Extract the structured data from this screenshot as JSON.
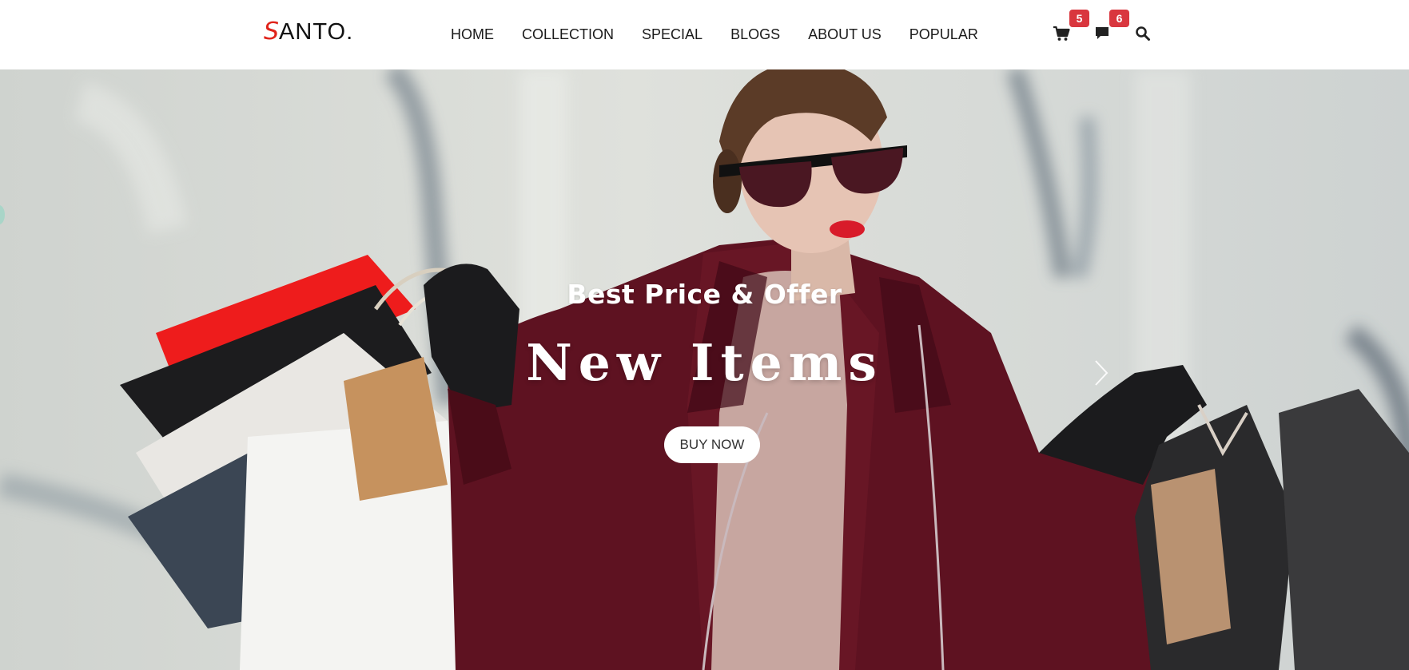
{
  "brand": {
    "logo_first": "S",
    "logo_rest": "ANTO.",
    "accent": "#e0241b"
  },
  "nav": {
    "items": [
      "HOME",
      "COLLECTION",
      "SPECIAL",
      "BLOGS",
      "ABOUT US",
      "POPULAR"
    ]
  },
  "header_icons": {
    "cart": {
      "icon": "cart-icon",
      "count": "5"
    },
    "messages": {
      "icon": "chat-icon",
      "count": "6"
    },
    "search": {
      "icon": "search-icon"
    },
    "badge_color": "#d9363e"
  },
  "hero": {
    "subtitle": "Best Price & Offer",
    "title": "New Items",
    "button_label": "BUY NOW",
    "next_icon": "chevron-right-icon",
    "coat_color": "#5e1221",
    "background_color": "#d5d8d4"
  }
}
